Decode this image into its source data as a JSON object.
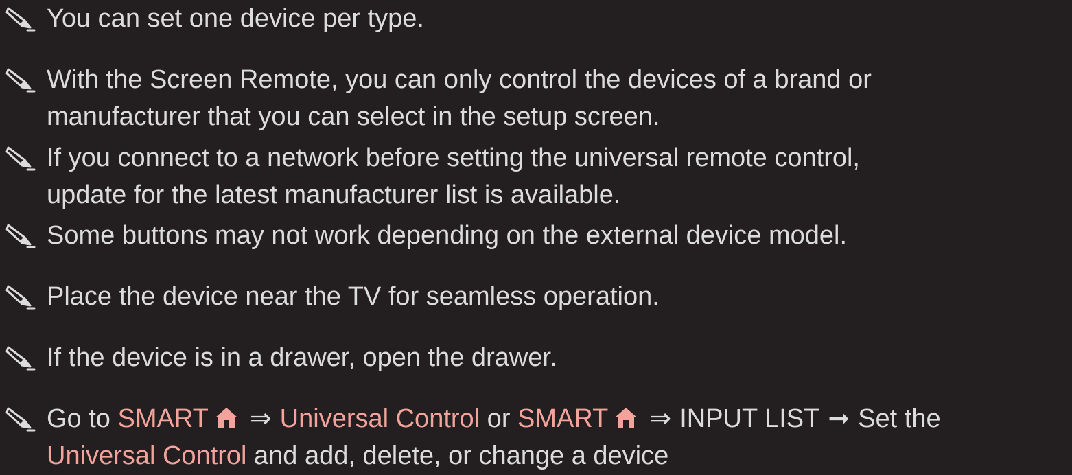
{
  "icon": "pencil-note-icon",
  "colors": {
    "background": "#231f20",
    "text": "#dcdcdc",
    "highlight": "#f4a39c"
  },
  "notes": [
    "You can set one device per type.",
    "With the Screen Remote, you can only control the devices of a brand or\nmanufacturer that you can select in the setup screen.",
    "If you connect to a network before setting the universal remote control,\nupdate for the latest manufacturer list is available.",
    "Some buttons may not work depending on the external device model.",
    "Place the device near the TV for seamless operation.",
    "If the device is in a drawer, open the drawer."
  ],
  "last_note": {
    "go_to": "Go to ",
    "smart_1": "SMART",
    "double_arrow_1": "⇒",
    "universal_control_1": "Universal Control",
    "or": " or ",
    "smart_2": "SMART",
    "double_arrow_2": "⇒",
    "input_list": "INPUT LIST",
    "arrow": "➞",
    "set_the": "Set the",
    "universal_control_2": "Universal Control",
    "tail": " and add, delete, or change a device"
  }
}
